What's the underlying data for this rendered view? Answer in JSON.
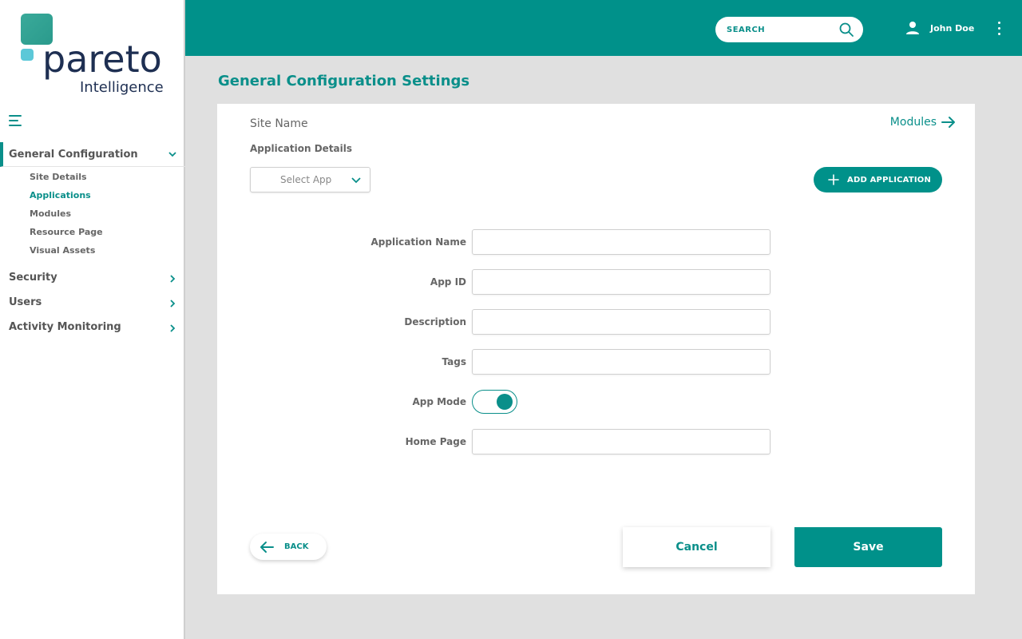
{
  "brand": {
    "name": "pareto",
    "tagline": "Intelligence"
  },
  "header": {
    "search_label": "SEARCH",
    "user_name": "John Doe",
    "accent": "#00918a"
  },
  "sidebar": {
    "sections": [
      {
        "label": "General Configuration",
        "expanded": true,
        "items": [
          {
            "label": "Site Details",
            "current": false
          },
          {
            "label": "Applications",
            "current": true
          },
          {
            "label": "Modules",
            "current": false
          },
          {
            "label": "Resource Page",
            "current": false
          },
          {
            "label": "Visual Assets",
            "current": false
          }
        ]
      },
      {
        "label": "Security",
        "expanded": false
      },
      {
        "label": "Users",
        "expanded": false
      },
      {
        "label": "Activity Monitoring",
        "expanded": false
      }
    ]
  },
  "main": {
    "title": "General Configuration Settings",
    "site_name": "Site Name",
    "modules_link": "Modules",
    "app_details_label": "Application Details",
    "select_app": "Select App",
    "add_application": "ADD APPLICATION",
    "form": {
      "application_name": {
        "label": "Application Name",
        "value": ""
      },
      "app_id": {
        "label": "App ID",
        "value": ""
      },
      "description": {
        "label": "Description",
        "value": ""
      },
      "tags": {
        "label": "Tags",
        "value": ""
      },
      "app_mode": {
        "label": "App Mode",
        "on": true
      },
      "home_page": {
        "label": "Home Page",
        "value": ""
      }
    },
    "back": "BACK",
    "cancel": "Cancel",
    "save": "Save"
  }
}
